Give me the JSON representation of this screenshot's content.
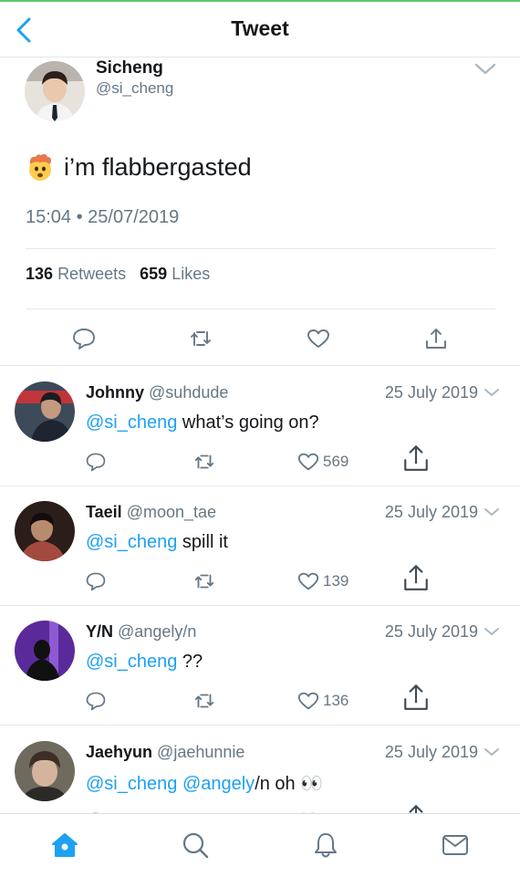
{
  "header": {
    "title": "Tweet",
    "back_icon": "back-chevron-icon"
  },
  "main_tweet": {
    "user": {
      "name": "Sicheng",
      "handle": "@si_cheng"
    },
    "emoji": "exploding-head-emoji",
    "text": "i’m flabbergasted",
    "timestamp": "15:04 • 25/07/2019",
    "stats": {
      "retweets_count": "136",
      "retweets_label": "Retweets",
      "likes_count": "659",
      "likes_label": "Likes"
    },
    "actions": [
      "reply-icon",
      "retweet-icon",
      "like-icon",
      "share-icon"
    ]
  },
  "replies": [
    {
      "name": "Johnny",
      "handle": "@suhdude",
      "date": "25 July 2019",
      "mention": "@si_cheng",
      "text": " what’s going on?",
      "likes": "569"
    },
    {
      "name": "Taeil",
      "handle": "@moon_tae",
      "date": "25 July 2019",
      "mention": "@si_cheng",
      "text": " spill it",
      "likes": "139"
    },
    {
      "name": "Y/N",
      "handle": "@angely/n",
      "date": "25 July 2019",
      "mention": "@si_cheng",
      "text": " ??",
      "likes": "136"
    },
    {
      "name": "Jaehyun",
      "handle": "@jaehunnie",
      "date": "25 July 2019",
      "mention": "@si_cheng",
      "mention2": "@angely",
      "text": "/n oh 👀"
    }
  ],
  "tabbar": {
    "items": [
      "home-icon",
      "search-icon",
      "notifications-icon",
      "messages-icon"
    ],
    "active": "home-icon"
  },
  "colors": {
    "accent": "#1da1f2",
    "secondary_text": "#657786",
    "divider": "#e1e8ed"
  }
}
